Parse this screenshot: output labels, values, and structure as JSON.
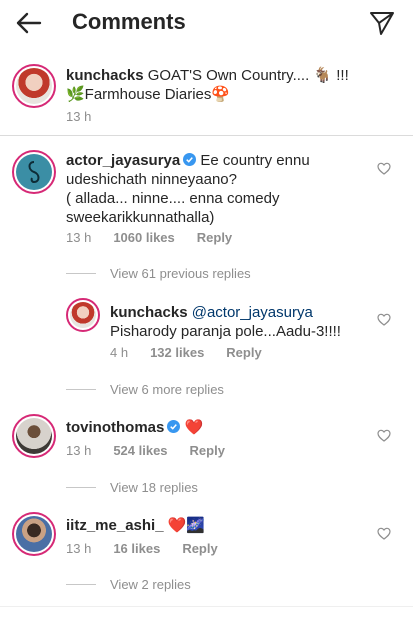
{
  "header": {
    "title": "Comments"
  },
  "caption": {
    "username": "kunchacks",
    "text_line1": "GOAT'S  Own Country.... 🐐 !!!",
    "text_line2": "🌿Farmhouse Diaries🍄",
    "time": "13 h"
  },
  "comments": [
    {
      "username": "actor_jayasurya",
      "text_line1": "Ee country ennu",
      "text_line2": "udeshichath ninneyaano?",
      "text_line3": "( allada... ninne.... enna comedy",
      "text_line4": "sweekarikkunnathalla)",
      "time": "13 h",
      "likes": "1060 likes",
      "reply": "Reply",
      "view_replies": "View 61 previous replies"
    },
    {
      "username": "kunchacks",
      "mention": "@actor_jayasurya",
      "text_line2": "Pisharody paranja pole...Aadu-3!!!!",
      "time": "4 h",
      "likes": "132 likes",
      "reply": "Reply",
      "view_replies": "View 6 more replies"
    },
    {
      "username": "tovinothomas",
      "emoji": "❤️",
      "time": "13 h",
      "likes": "524 likes",
      "reply": "Reply",
      "view_replies": "View 18 replies"
    },
    {
      "username": "iitz_me_ashi_",
      "emoji": "❤️🌌",
      "time": "13 h",
      "likes": "16 likes",
      "reply": "Reply",
      "view_replies": "View 2 replies"
    }
  ],
  "colors": {
    "verified": "#3897f0",
    "story_ring": "#d62976",
    "meta": "#8e8e8e"
  }
}
